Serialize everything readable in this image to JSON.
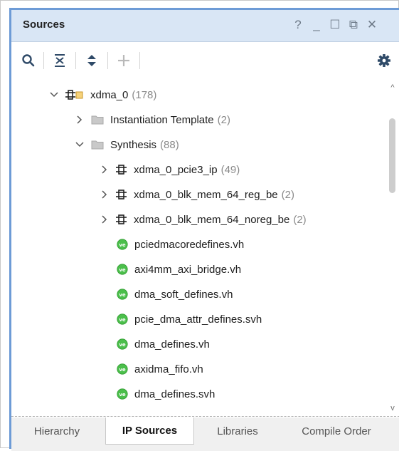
{
  "panel": {
    "title": "Sources",
    "controls": [
      "?",
      "_",
      "☐",
      "⧉",
      "✕"
    ]
  },
  "toolbar": {
    "buttons": [
      "search-icon",
      "collapse-all-icon",
      "expand-all-icon",
      "add-icon",
      "gear-icon"
    ]
  },
  "tree": {
    "rows": [
      {
        "name": "xdma_0",
        "count": "(178)",
        "icon": "ip-core-icon",
        "expander": "down"
      },
      {
        "name": "Instantiation Template",
        "count": "(2)",
        "icon": "folder-icon",
        "expander": "right"
      },
      {
        "name": "Synthesis",
        "count": "(88)",
        "icon": "folder-icon",
        "expander": "down"
      },
      {
        "name": "xdma_0_pcie3_ip",
        "count": "(49)",
        "icon": "ip-icon",
        "expander": "right"
      },
      {
        "name": "xdma_0_blk_mem_64_reg_be",
        "count": "(2)",
        "icon": "ip-icon",
        "expander": "right"
      },
      {
        "name": "xdma_0_blk_mem_64_noreg_be",
        "count": "(2)",
        "icon": "ip-icon",
        "expander": "right"
      },
      {
        "name": "pciedmacoredefines.vh",
        "count": "",
        "icon": "verilog-header-icon",
        "expander": "none"
      },
      {
        "name": "axi4mm_axi_bridge.vh",
        "count": "",
        "icon": "verilog-header-icon",
        "expander": "none"
      },
      {
        "name": "dma_soft_defines.vh",
        "count": "",
        "icon": "verilog-header-icon",
        "expander": "none"
      },
      {
        "name": "pcie_dma_attr_defines.svh",
        "count": "",
        "icon": "verilog-header-icon",
        "expander": "none"
      },
      {
        "name": "dma_defines.vh",
        "count": "",
        "icon": "verilog-header-icon",
        "expander": "none"
      },
      {
        "name": "axidma_fifo.vh",
        "count": "",
        "icon": "verilog-header-icon",
        "expander": "none"
      },
      {
        "name": "dma_defines.svh",
        "count": "",
        "icon": "verilog-header-icon",
        "expander": "none"
      }
    ]
  },
  "tabs": [
    {
      "label": "Hierarchy",
      "active": false
    },
    {
      "label": "IP Sources",
      "active": true
    },
    {
      "label": "Libraries",
      "active": false
    },
    {
      "label": "Compile Order",
      "active": false
    }
  ],
  "colors": {
    "titlebar": "#d9e6f5",
    "accent_border": "#6d9bd6",
    "header_file_icon": "#4bbf4b",
    "folder": "#bdbdbd",
    "ip_badge": "#e8b22e"
  }
}
